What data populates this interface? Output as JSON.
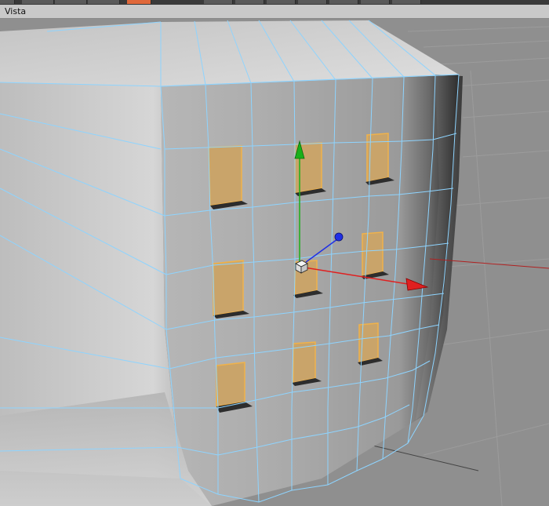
{
  "menubar": {
    "items": [
      {
        "label": "Vista"
      }
    ]
  },
  "viewport": {
    "name": "3d-perspective-viewport",
    "background_color": "#8f8f8f",
    "wireframe_color": "#8ed4ff",
    "window_fill_color": "#c9a46a",
    "window_edge_color": "#f0b24a",
    "gizmo": {
      "x_axis_color": "#e02020",
      "y_axis_color": "#19b019",
      "z_axis_color": "#1f2fe6"
    }
  }
}
